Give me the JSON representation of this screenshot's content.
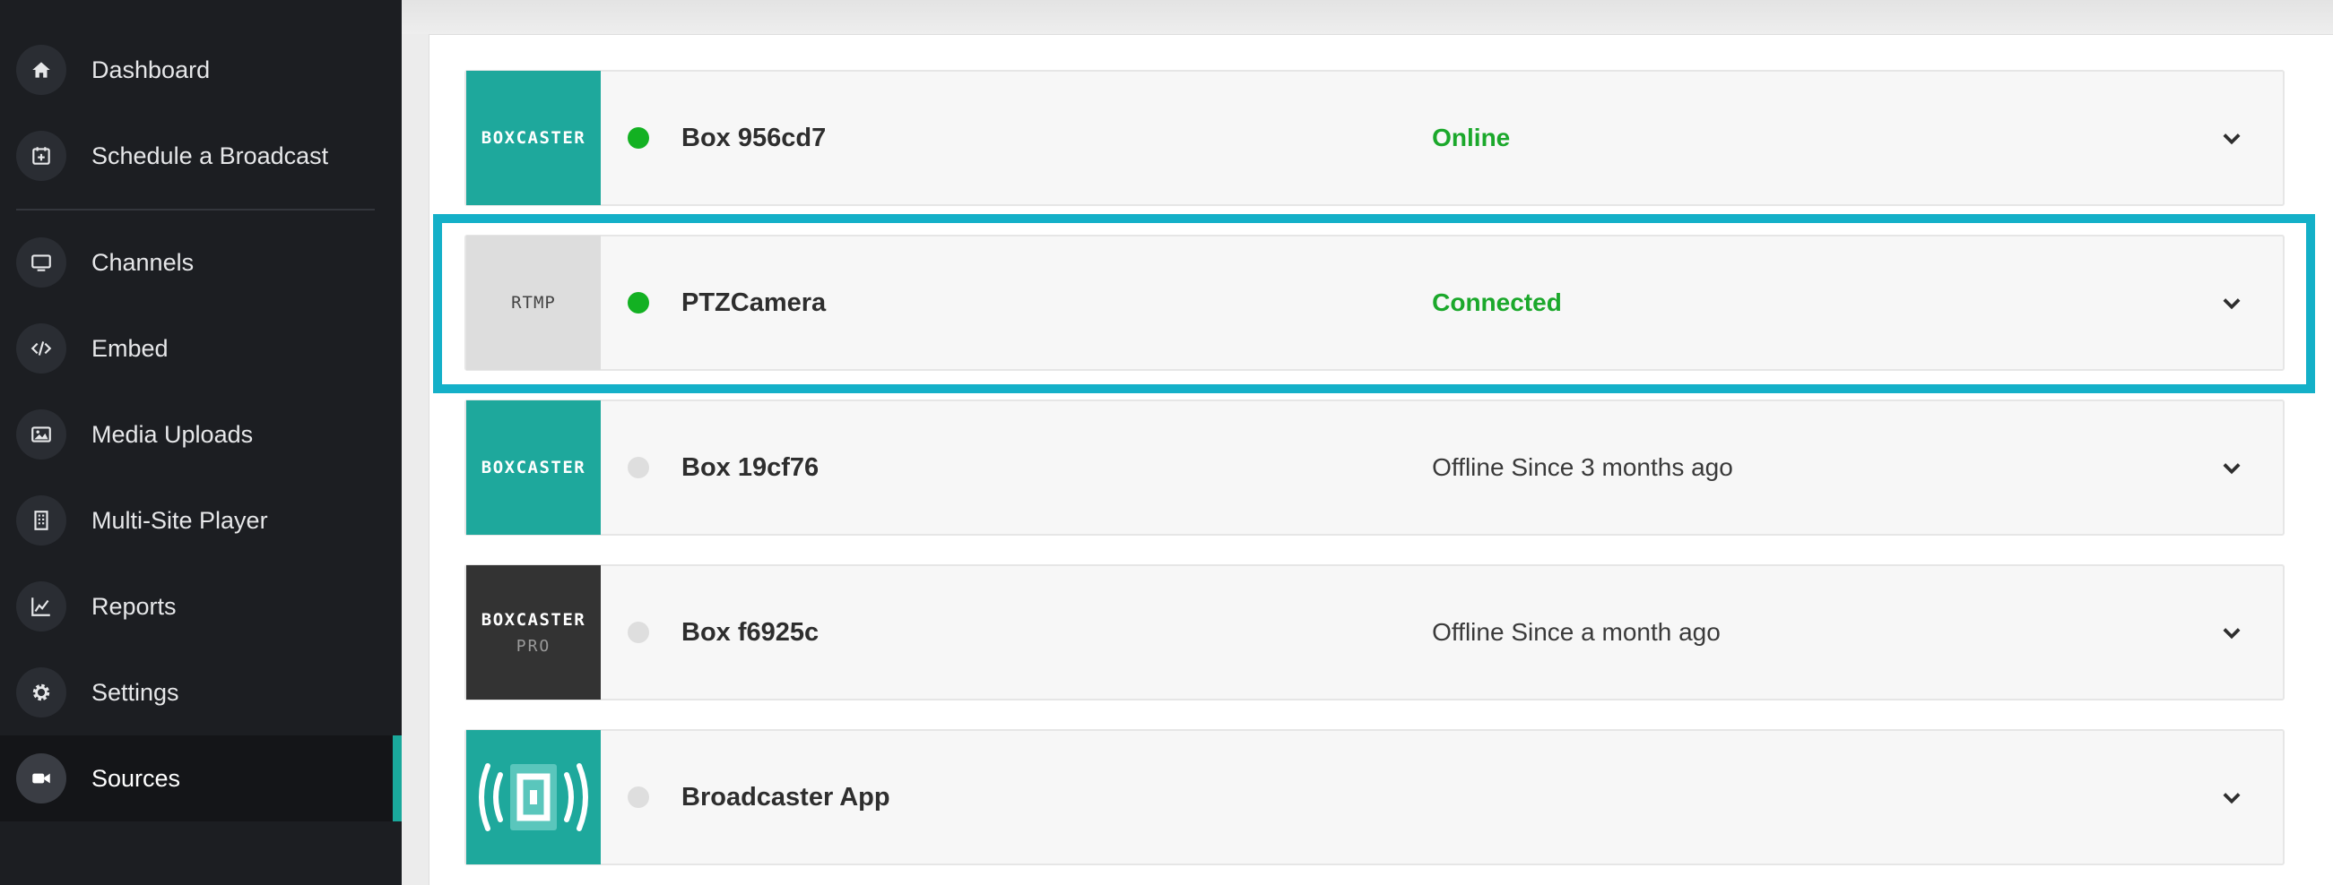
{
  "sidebar": {
    "items": [
      {
        "label": "Dashboard",
        "icon": "home-icon"
      },
      {
        "label": "Schedule a Broadcast",
        "icon": "calendar-plus-icon"
      },
      {
        "label": "Channels",
        "icon": "monitor-icon"
      },
      {
        "label": "Embed",
        "icon": "code-icon"
      },
      {
        "label": "Media Uploads",
        "icon": "image-icon"
      },
      {
        "label": "Multi-Site Player",
        "icon": "building-icon"
      },
      {
        "label": "Reports",
        "icon": "line-chart-icon"
      },
      {
        "label": "Settings",
        "icon": "gear-icon"
      },
      {
        "label": "Sources",
        "icon": "video-camera-icon",
        "active": true
      }
    ]
  },
  "sources": [
    {
      "thumb": "BOXCASTER",
      "thumb_sub": "",
      "name": "Box 956cd7",
      "status": "Online",
      "connected": true
    },
    {
      "thumb": "RTMP",
      "thumb_sub": "",
      "name": "PTZCamera",
      "status": "Connected",
      "connected": true,
      "highlighted": true
    },
    {
      "thumb": "BOXCASTER",
      "thumb_sub": "",
      "name": "Box 19cf76",
      "status": "Offline Since 3 months ago",
      "connected": false
    },
    {
      "thumb": "BOXCASTER",
      "thumb_sub": "PRO",
      "name": "Box f6925c",
      "status": "Offline Since a month ago",
      "connected": false
    },
    {
      "thumb": "broadcaster-app-icon",
      "thumb_sub": "",
      "name": "Broadcaster App",
      "status": "",
      "connected": false
    }
  ],
  "colors": {
    "sidebar_bg": "#1c1e22",
    "accent_teal": "#1ea89c",
    "status_green": "#1ba82b",
    "highlight_cyan": "#14b0c8"
  }
}
